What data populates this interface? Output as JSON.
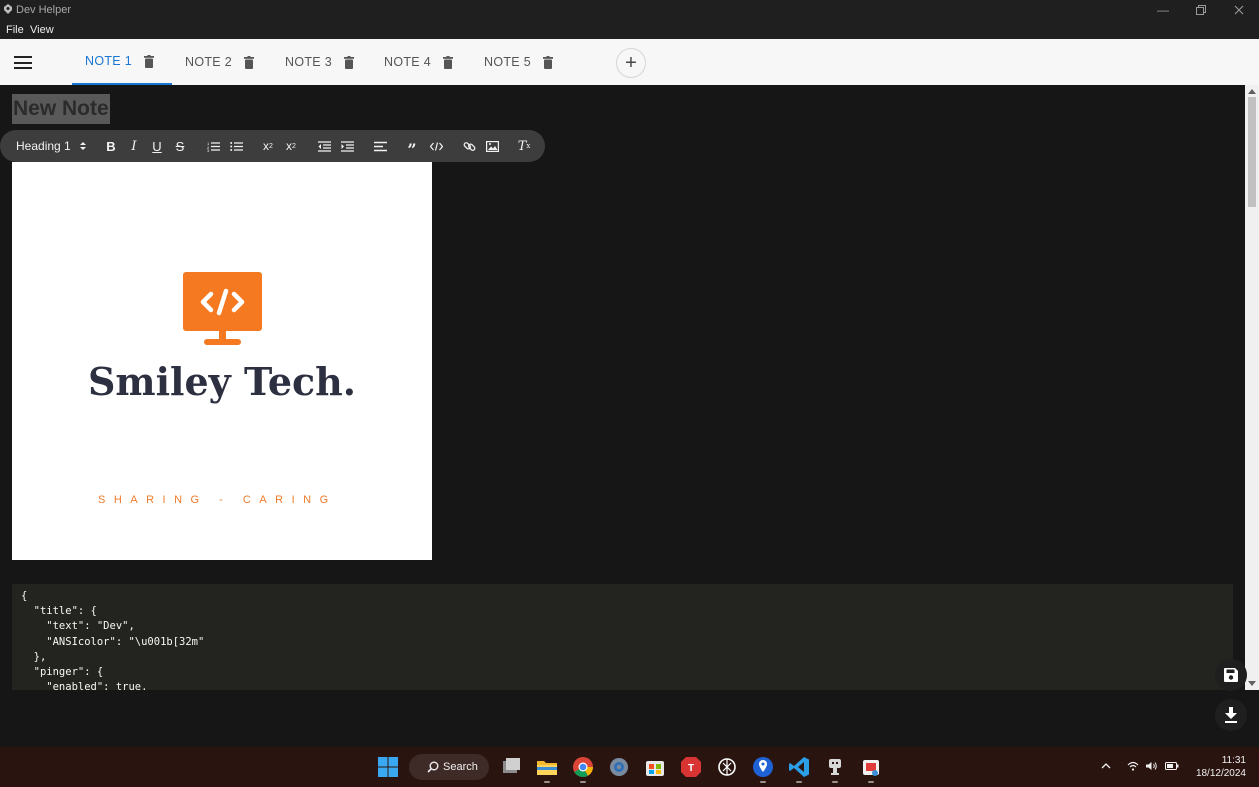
{
  "window": {
    "title": "Dev Helper"
  },
  "menu": {
    "file": "File",
    "view": "View"
  },
  "tabs": [
    {
      "label": "NOTE 1",
      "active": true
    },
    {
      "label": "NOTE 2",
      "active": false
    },
    {
      "label": "NOTE 3",
      "active": false
    },
    {
      "label": "NOTE 4",
      "active": false
    },
    {
      "label": "NOTE 5",
      "active": false
    }
  ],
  "note": {
    "title": "New Note"
  },
  "toolbar": {
    "heading_select": "Heading 1",
    "buttons": [
      "bold",
      "italic",
      "underline",
      "strike",
      "ordered-list",
      "bullet-list",
      "subscript",
      "superscript",
      "outdent",
      "indent",
      "align",
      "blockquote",
      "code-block",
      "link",
      "image",
      "clean"
    ]
  },
  "image": {
    "brand": "Smiley Tech.",
    "tagline": "SHARING - CARING",
    "accent_color": "#f47920",
    "text_color": "#2d3040"
  },
  "code": {
    "lines": [
      "{",
      "  \"title\": {",
      "    \"text\": \"Dev\",",
      "    \"ANSIcolor\": \"\\u001b[32m\"",
      "  },",
      "  \"pinger\": {",
      "    \"enabled\": true,"
    ]
  },
  "taskbar": {
    "search_label": "Search",
    "time": "11:31",
    "date": "18/12/2024"
  },
  "colors": {
    "accent": "#1976d2",
    "editor_bg": "#161616",
    "taskbar_bg": "#2a1410"
  }
}
